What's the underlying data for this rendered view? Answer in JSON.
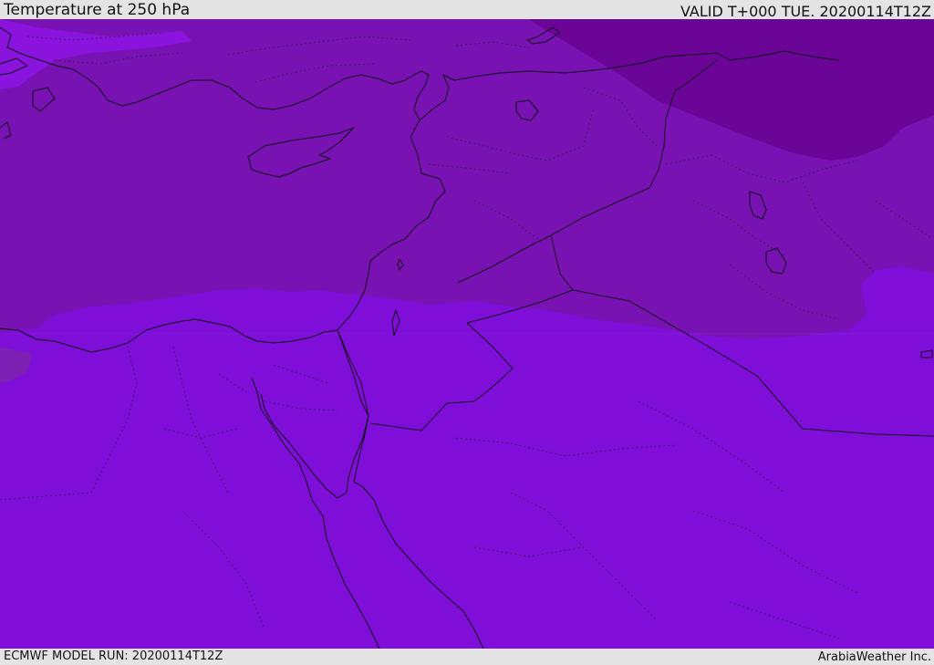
{
  "header": {
    "title": "Temperature at 250 hPa",
    "valid_time": "VALID T+000 TUE. 20200114T12Z"
  },
  "footer": {
    "model_run": "ECMWF MODEL RUN: 20200114T12Z",
    "credit": "ArabiaWeather Inc."
  },
  "map": {
    "field": "temperature",
    "level": "250 hPa",
    "colors": {
      "band_coldest": "#6a0598",
      "band_cold": "#7812b2",
      "band_mild": "#7e0ed8",
      "band_light": "#8a14de",
      "band_faint": "#7c20b4",
      "coastline": "#0d0a14"
    }
  }
}
